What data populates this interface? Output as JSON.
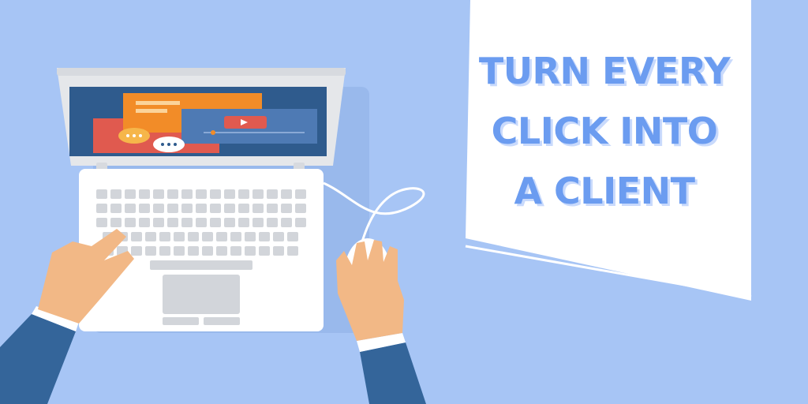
{
  "headline": {
    "lines": [
      "TURN EVERY",
      "CLICK INTO",
      "A CLIENT"
    ]
  },
  "colors": {
    "background": "#a7c5f5",
    "headline_text": "#6b9cf0",
    "headline_shadow": "#c9dafc",
    "banner": "#ffffff",
    "laptop_body": "#ffffff",
    "screen_bg": "#2f5b8d",
    "video_red": "#e05a4f",
    "orange_window": "#f28c28",
    "sleeve": "#34659a",
    "skin": "#f2b886"
  },
  "illustration": {
    "video_play_icon": "play-icon",
    "chat_icons": [
      "speech-bubble-icon",
      "speech-bubble-icon"
    ]
  }
}
